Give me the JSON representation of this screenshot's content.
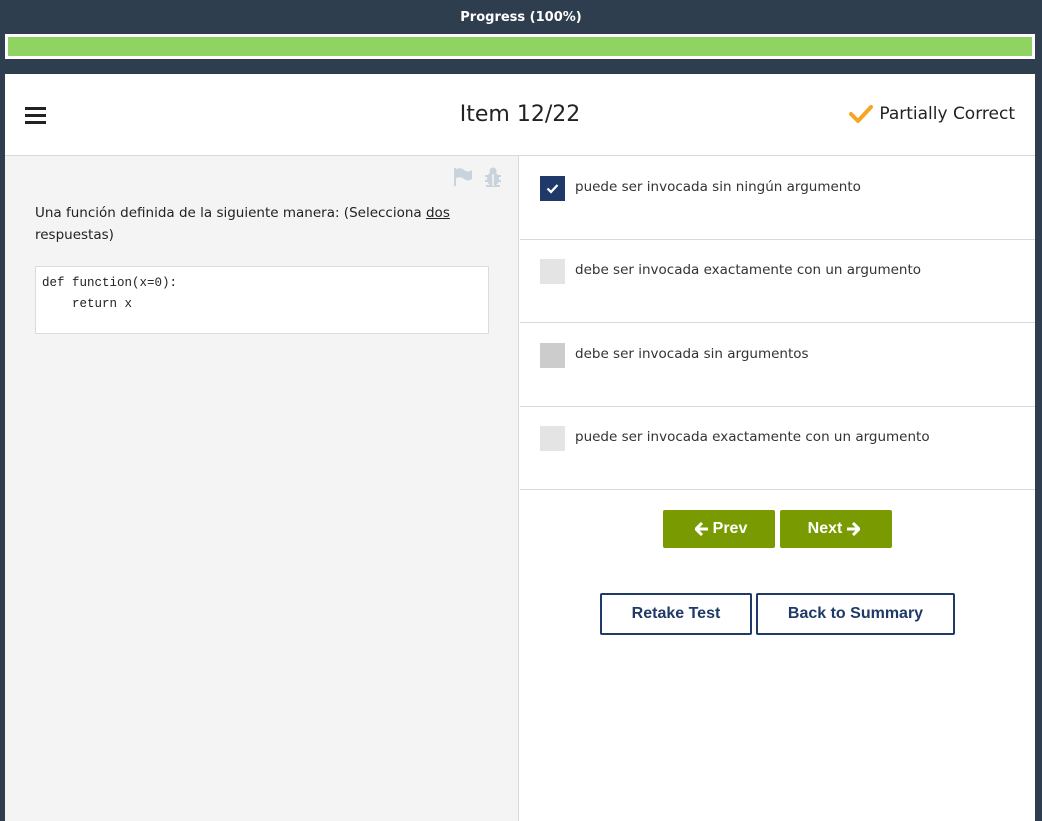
{
  "progress": {
    "title": "Progress (100%)",
    "fraction": 1.0,
    "fill_color": "#8fd362"
  },
  "header": {
    "menu_icon": "hamburger-menu-icon",
    "item_title": "Item 12/22",
    "status_icon": "checkmark-icon",
    "status_color": "#f5a623",
    "status_text": "Partially Correct"
  },
  "question": {
    "tools": [
      "flag-icon",
      "bug-icon"
    ],
    "text_before": "Una función definida de la siguiente manera:  (Selecciona ",
    "text_underlined": "dos",
    "text_after": " respuestas)",
    "code": "def function(x=0):\n    return x"
  },
  "options": [
    {
      "label": "puede ser invocada sin ningún argumento",
      "state": "checked"
    },
    {
      "label": "debe ser invocada exactamente con un argumento",
      "state": "unchecked"
    },
    {
      "label": "debe ser invocada sin argumentos",
      "state": "highlighted"
    },
    {
      "label": "puede ser invocada exactamente con un argumento",
      "state": "unchecked"
    }
  ],
  "nav": {
    "prev_label": "Prev",
    "prev_icon": "arrow-left-icon",
    "next_label": "Next",
    "next_icon": "arrow-right-icon",
    "accent": "#7a9a01"
  },
  "actions": {
    "retake_label": "Retake Test",
    "summary_label": "Back to Summary",
    "color": "#1f3a68"
  }
}
